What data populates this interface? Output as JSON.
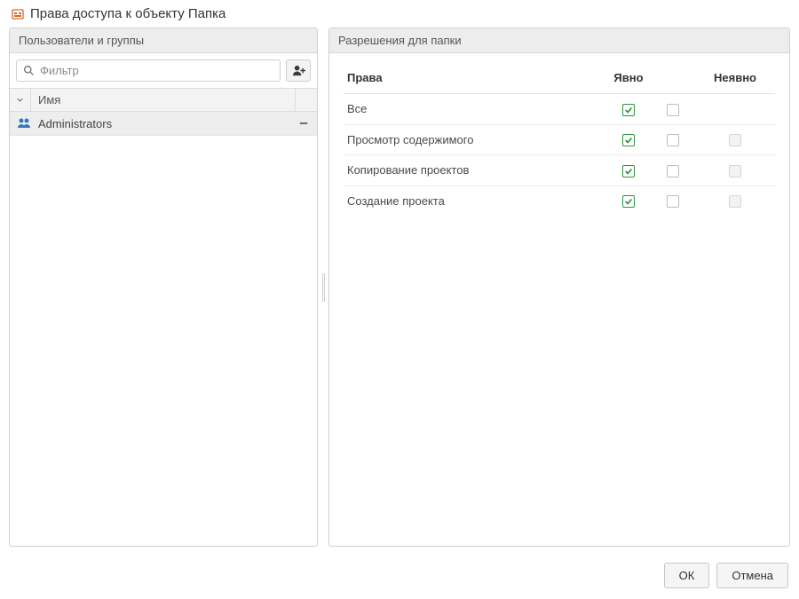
{
  "title": "Права доступа к объекту Папка",
  "left_panel": {
    "header": "Пользователи и группы",
    "filter_placeholder": "Фильтр",
    "column_name": "Имя",
    "items": [
      {
        "name": "Administrators"
      }
    ]
  },
  "right_panel": {
    "header": "Разрешения для папки",
    "col_rights": "Права",
    "col_explicit_allow": "Явно",
    "col_implicit": "Неявно",
    "rows": [
      {
        "label": "Все",
        "explicit_allow": true,
        "explicit_deny": false,
        "implicit_visible": false,
        "implicit": false
      },
      {
        "label": "Просмотр содержимого",
        "explicit_allow": true,
        "explicit_deny": false,
        "implicit_visible": true,
        "implicit": false
      },
      {
        "label": "Копирование проектов",
        "explicit_allow": true,
        "explicit_deny": false,
        "implicit_visible": true,
        "implicit": false
      },
      {
        "label": "Создание проекта",
        "explicit_allow": true,
        "explicit_deny": false,
        "implicit_visible": true,
        "implicit": false
      }
    ]
  },
  "footer": {
    "ok": "ОК",
    "cancel": "Отмена"
  }
}
